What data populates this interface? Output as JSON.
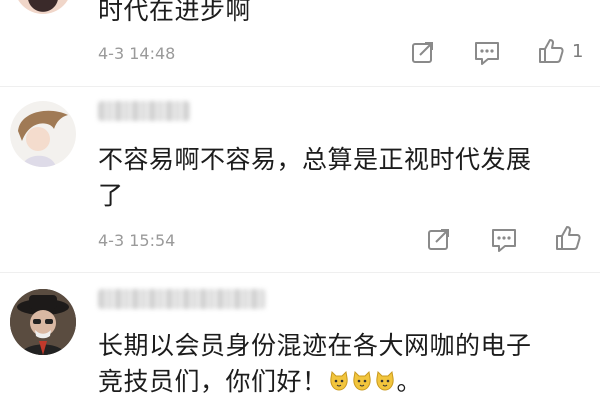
{
  "comments": [
    {
      "text_lines": [
        "时代在进步啊"
      ],
      "time": "4-3 14:48",
      "like_count": "1"
    },
    {
      "text_lines": [
        "不容易啊不容易，总算是正视时代发展",
        "了"
      ],
      "time": "4-3 15:54",
      "like_count": ""
    },
    {
      "text_lines": [
        "长期以会员身份混迹在各大网咖的电子",
        "竞技员们，你们好！"
      ],
      "text_suffix": "。",
      "emoji_count": 3
    }
  ],
  "icons": {
    "share": "share-icon",
    "comment": "comment-icon",
    "like": "thumbs-up-icon"
  },
  "colors": {
    "text": "#1c1c1c",
    "meta": "#9a9a9a",
    "icon": "#8a8a8a",
    "emoji": "#f2c53d"
  }
}
